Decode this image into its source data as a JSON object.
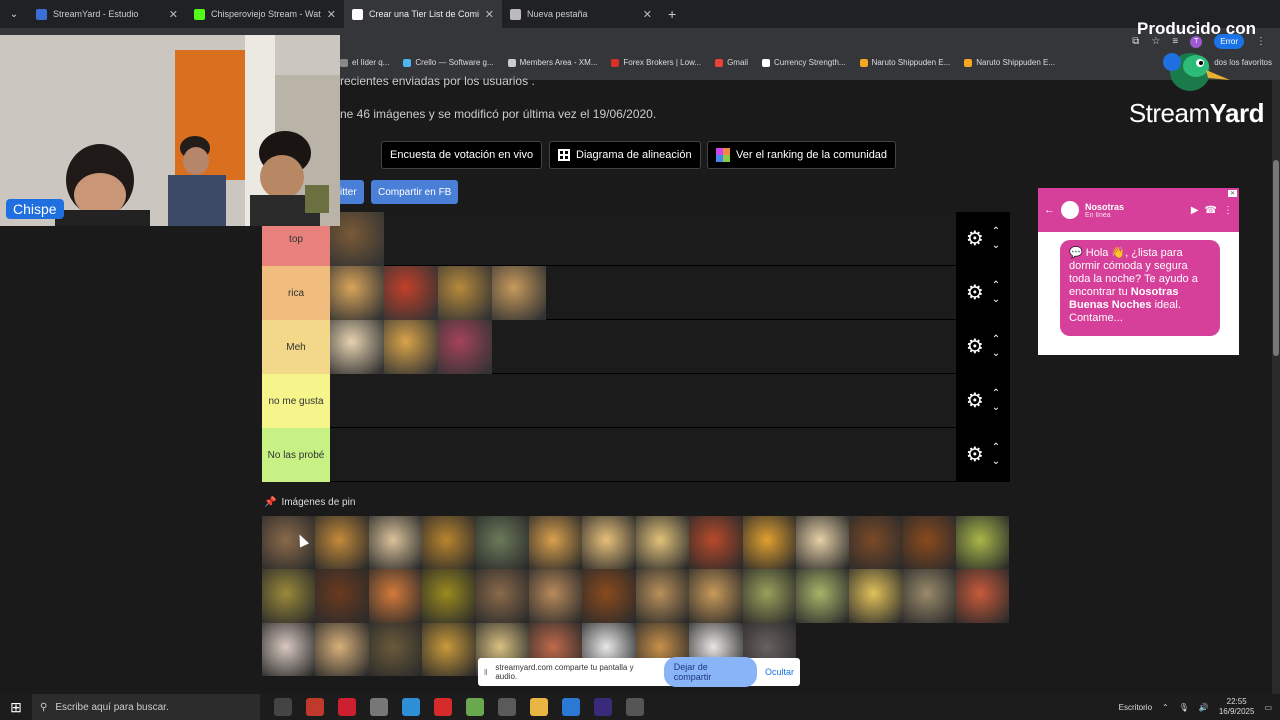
{
  "browser": {
    "tabs": [
      {
        "title": "StreamYard - Estudio",
        "color": "#3b6fd8",
        "active": false
      },
      {
        "title": "Chisperoviejo Stream - Watch L",
        "color": "#53fc18",
        "active": false
      },
      {
        "title": "Crear una Tier List de Comidas",
        "color": "#ffffff",
        "active": true
      },
      {
        "title": "Nueva pestaña",
        "color": "#bbbbbb",
        "active": false
      }
    ],
    "bookmarks": [
      {
        "label": "el líder q...",
        "color": "#888888"
      },
      {
        "label": "Crello — Software g...",
        "color": "#4db6f0"
      },
      {
        "label": "Members Area - XM...",
        "color": "#cccccc"
      },
      {
        "label": "Forex Brokers | Low...",
        "color": "#d93025"
      },
      {
        "label": "Gmail",
        "color": "#ea4335"
      },
      {
        "label": "Currency Strength...",
        "color": "#ffffff"
      },
      {
        "label": "Naruto Shippuden E...",
        "color": "#f5a623"
      },
      {
        "label": "Naruto Shippuden E...",
        "color": "#f5a623"
      }
    ],
    "bookmarks_right": "dos los favoritos",
    "error_label": "Error",
    "profile_initial": "T"
  },
  "page": {
    "intro_line1": "recientes enviadas por los usuarios .",
    "intro_line2": "ne 46 imágenes y se modificó por última vez el 19/06/2020.",
    "buttons": [
      {
        "label": "Encuesta de votación en vivo",
        "icon": "none"
      },
      {
        "label": "Diagrama de alineación",
        "icon": "grid-icon"
      },
      {
        "label": "Ver el ranking de la comunidad",
        "icon": "ranking-icon"
      }
    ],
    "share_twitter": "itter",
    "share_fb": "Compartir en FB",
    "tiers": [
      {
        "label": "top",
        "color": "#e8807c",
        "items": [
          "#7a5a36"
        ]
      },
      {
        "label": "rica",
        "color": "#f0bd7e",
        "items": [
          "#d8a45a",
          "#c2402a",
          "#b78a3c",
          "#c79a5c"
        ]
      },
      {
        "label": "Meh",
        "color": "#f3d889",
        "items": [
          "#e6d2b0",
          "#d9a44a",
          "#a4435a"
        ]
      },
      {
        "label": "no me gusta",
        "color": "#f5f58b",
        "items": []
      },
      {
        "label": "No las probé",
        "color": "#c7f085",
        "items": []
      }
    ],
    "pin_title": "Imágenes de pin",
    "pin_items": [
      "#8a6a4a",
      "#c48a3a",
      "#d9c29a",
      "#b9852e",
      "#6b7a5a",
      "#d9a04c",
      "#e6c07a",
      "#e2c27a",
      "#b84a2a",
      "#e0a030",
      "#e6d0a6",
      "#7a4a28",
      "#8a4a1e",
      "#a8b84a",
      "#9a8a3a",
      "#6a3a1e",
      "#d47a3a",
      "#9a8a1e",
      "#8a6a4a",
      "#b88a5a",
      "#8a4a1e",
      "#b8905a",
      "#c99a5a",
      "#9aa05a",
      "#a8b46a",
      "#e2c25a",
      "#9a8a6a",
      "#c85a3a",
      "#d8c8c0",
      "#d8b07a",
      "#6a5a3a",
      "#c89a3a",
      "#d8c080",
      "#c06a4a",
      "#e8e8e8",
      "#c8904a",
      "#e8e6e4",
      "#6a6060"
    ]
  },
  "share_notice": {
    "text": "streamyard.com comparte tu pantalla y audio.",
    "stop": "Dejar de compartir",
    "hide": "Ocultar"
  },
  "webcam": {
    "name": "Chispe"
  },
  "brand": {
    "produced": "Producido con",
    "name_light": "Stream",
    "name_bold": "Yard"
  },
  "ad": {
    "name": "Nosotras",
    "status": "En línea",
    "message_pre": "💬 Hola 👋, ¿lista para dormir cómoda y segura toda la noche? Te ayudo a encontrar tu ",
    "message_bold": "Nosotras Buenas Noches",
    "message_post": " ideal. Contame...",
    "close": "✕"
  },
  "taskbar": {
    "search_placeholder": "Escribe aquí para buscar.",
    "desktop_label": "Escritorio",
    "time": "22:55",
    "date": "16/9/2025",
    "apps": [
      {
        "icon": "task-view-icon",
        "color": "#444444"
      },
      {
        "icon": "app-icon",
        "color": "#c0392b"
      },
      {
        "icon": "opera-icon",
        "color": "#cc1f2f"
      },
      {
        "icon": "photos-icon",
        "color": "#777777"
      },
      {
        "icon": "app-icon",
        "color": "#2d8fd5"
      },
      {
        "icon": "opera-gx-icon",
        "color": "#d62b2b"
      },
      {
        "icon": "app-icon",
        "color": "#6aa84f"
      },
      {
        "icon": "chrome-icon",
        "color": "#5a5a5a"
      },
      {
        "icon": "file-explorer-icon",
        "color": "#e9b543"
      },
      {
        "icon": "browser-icon",
        "color": "#2b79d4"
      },
      {
        "icon": "obs-icon",
        "color": "#3a2a7a"
      },
      {
        "icon": "settings-icon",
        "color": "#555555"
      }
    ]
  }
}
